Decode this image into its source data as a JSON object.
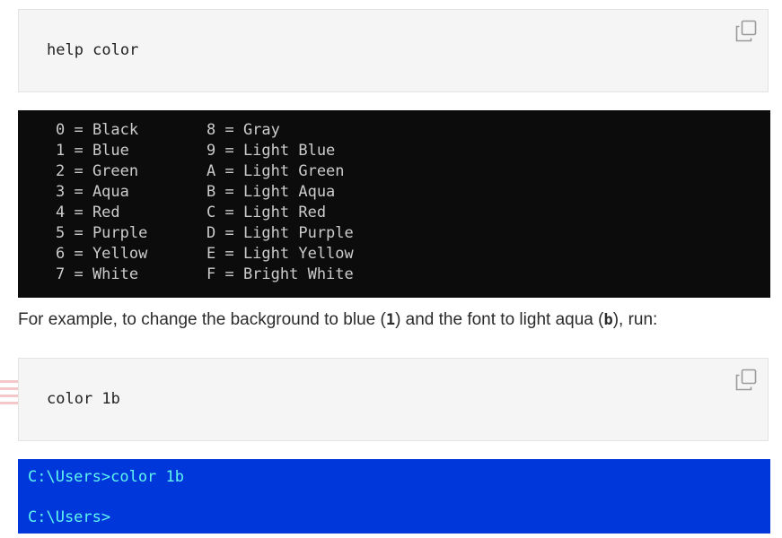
{
  "help_box": {
    "command": "help color",
    "copy_icon": "copy-icon"
  },
  "color_table": {
    "left": [
      "0 = Black",
      "1 = Blue",
      "2 = Green",
      "3 = Aqua",
      "4 = Red",
      "5 = Purple",
      "6 = Yellow",
      "7 = White"
    ],
    "right": [
      "8 = Gray",
      "9 = Light Blue",
      "A = Light Green",
      "B = Light Aqua",
      "C = Light Red",
      "D = Light Purple",
      "E = Light Yellow",
      "F = Bright White"
    ]
  },
  "paragraph": {
    "part1": "For example, to change the background to blue (",
    "bold1": "1",
    "part2": ") and the font to light aqua (",
    "bold2": "b",
    "part3": "), run:"
  },
  "color_box": {
    "command": "color 1b",
    "copy_icon": "copy-icon"
  },
  "blue_console": {
    "line1": "C:\\Users>color 1b",
    "line2": "C:\\Users>"
  },
  "colors": {
    "console_black": "#0c0c0c",
    "console_gray_text": "#cccccc",
    "console_blue": "#0037da",
    "console_aqua_text": "#5ef5ef",
    "code_box_bg": "#f5f5f5"
  }
}
